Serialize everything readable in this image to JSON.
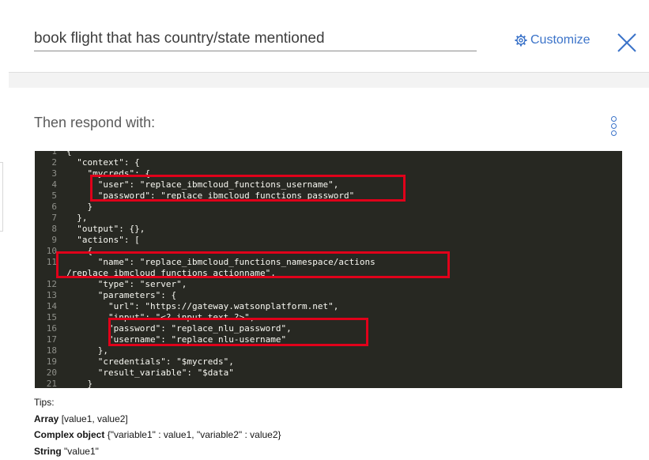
{
  "header": {
    "condition_value": "book flight that has country/state mentioned",
    "customize_label": "Customize"
  },
  "response": {
    "label": "Then respond with:"
  },
  "editor": {
    "lines": [
      {
        "n": "1",
        "t": "{"
      },
      {
        "n": "2",
        "t": "  \"context\": {"
      },
      {
        "n": "3",
        "t": "    \"mycreds\": {"
      },
      {
        "n": "4",
        "t": "      \"user\": \"replace_ibmcloud_functions_username\","
      },
      {
        "n": "5",
        "t": "      \"password\": \"replace_ibmcloud_functions_password\""
      },
      {
        "n": "6",
        "t": "    }"
      },
      {
        "n": "7",
        "t": "  },"
      },
      {
        "n": "8",
        "t": "  \"output\": {},"
      },
      {
        "n": "9",
        "t": "  \"actions\": ["
      },
      {
        "n": "10",
        "t": "    {"
      },
      {
        "n": "11",
        "t": "      \"name\": \"replace_ibmcloud_functions_namespace/actions"
      },
      {
        "n": "",
        "t": "/replace_ibmcloud_functions_actionname\","
      },
      {
        "n": "12",
        "t": "      \"type\": \"server\","
      },
      {
        "n": "13",
        "t": "      \"parameters\": {"
      },
      {
        "n": "14",
        "t": "        \"url\": \"https://gateway.watsonplatform.net\","
      },
      {
        "n": "15",
        "t": "        \"input\": \"<? input.text ?>\","
      },
      {
        "n": "16",
        "t": "        \"password\": \"replace_nlu_password\","
      },
      {
        "n": "17",
        "t": "        \"username\": \"replace_nlu-username\""
      },
      {
        "n": "18",
        "t": "      },"
      },
      {
        "n": "19",
        "t": "      \"credentials\": \"$mycreds\","
      },
      {
        "n": "20",
        "t": "      \"result_variable\": \"$data\""
      },
      {
        "n": "21",
        "t": "    }"
      }
    ]
  },
  "tips": {
    "title": "Tips:",
    "items": [
      {
        "term": "Array",
        "desc": " [value1, value2]"
      },
      {
        "term": "Complex object",
        "desc": " {\"variable1\" : value1, \"variable2\" : value2}"
      },
      {
        "term": "String",
        "desc": " \"value1\""
      }
    ]
  },
  "colors": {
    "accent": "#3b73c9",
    "editor_bg": "#272822",
    "highlight_box": "#e0001a"
  }
}
